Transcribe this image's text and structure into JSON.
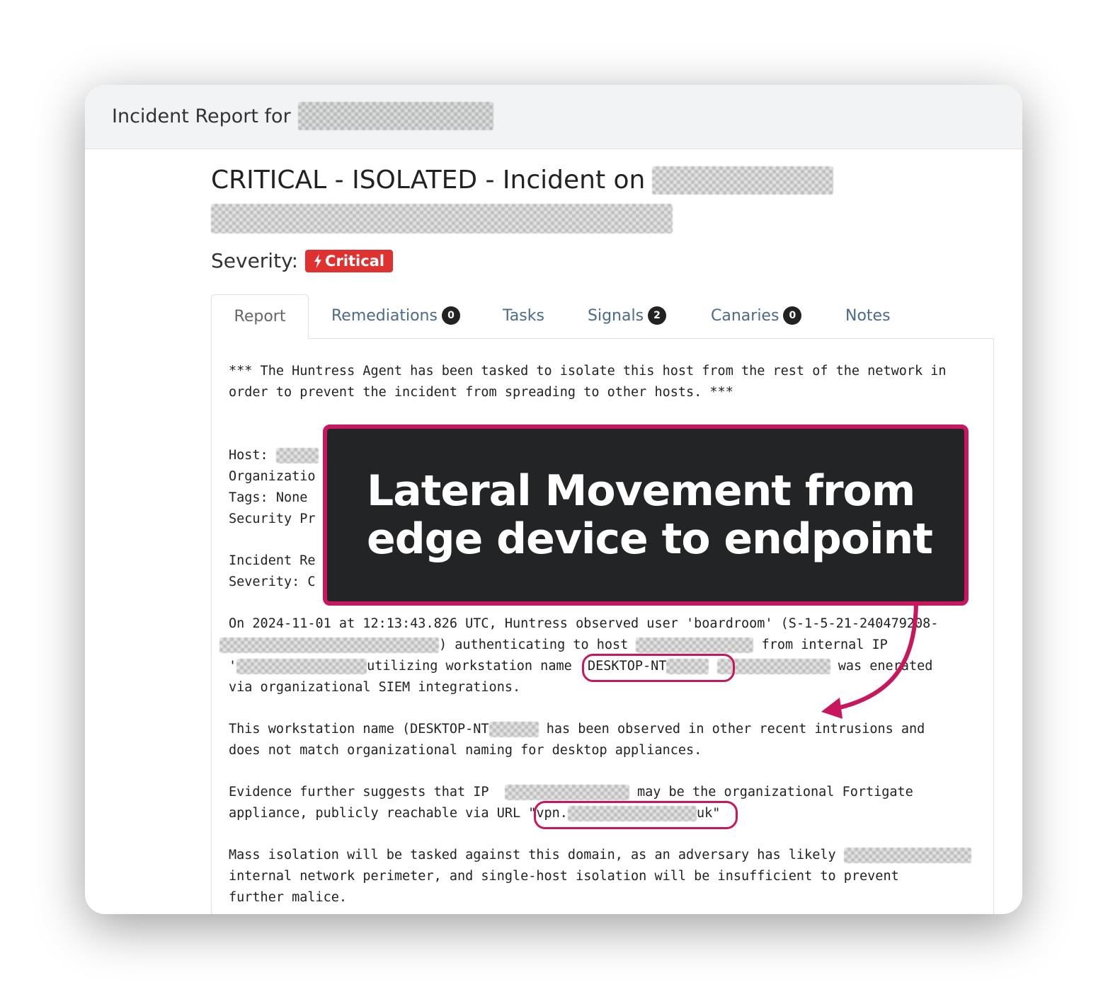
{
  "header": {
    "title": "Incident Report for"
  },
  "incident": {
    "title": "CRITICAL - ISOLATED - Incident on",
    "severity_label": "Severity:",
    "severity_badge": "Critical",
    "severity_icon": "bolt-icon",
    "badge_color": "#e03131"
  },
  "tabs": [
    {
      "label": "Report",
      "count": ""
    },
    {
      "label": "Remediations",
      "count": "0"
    },
    {
      "label": "Tasks",
      "count": ""
    },
    {
      "label": "Signals",
      "count": "2"
    },
    {
      "label": "Canaries",
      "count": "0"
    },
    {
      "label": "Notes",
      "count": ""
    }
  ],
  "report": {
    "intro1": "*** The Huntress Agent has been tasked to isolate this host from the rest of the network in",
    "intro2": "order to prevent the incident from spreading to other hosts. ***",
    "host": "Host:",
    "organization": "Organizatio",
    "tags": "Tags: None",
    "security": "Security Pr",
    "incident_re": "Incident Re",
    "severity_c": "Severity: C",
    "p1_l1": "On 2024-11-01 at 12:13:43.826 UTC, Huntress observed user 'boardroom' (S-1-5-21-2404",
    "p1_l1b": "79208-",
    "p1_l2a": ") authenticating to host",
    "p1_l2b": "from internal IP",
    "p1_l3a": "'",
    "p1_l3b": "utilizing workstation name",
    "p1_l3c": "'DESKTOP-NT",
    "p1_l3d": "was",
    "p1_l3e": "enerated",
    "p1_l4": "via organizational SIEM integrations.",
    "p2_l1a": "This workstation name (DESKTOP-NT",
    "p2_l1b": "has been observed in other recent intrusions and",
    "p2_l2": "does not match organizational naming for desktop appliances.",
    "p3_l1a": "Evidence further suggests that IP",
    "p3_l1b": "may be the organizational Fortigate",
    "p3_l2a": "appliance, publicly reachable via URL",
    "p3_l2b": "\"vpn.",
    "p3_l2c": "uk\"",
    "p4_l1": "Mass isolation will be tasked against this domain, as an adversary has likely",
    "p4_l2": "internal network perimeter, and single-host isolation will be insufficient to prevent",
    "p4_l3": "further malice."
  },
  "callout": {
    "line1": "Lateral Movement from",
    "line2": "edge device to endpoint",
    "accent": "#c8175d",
    "background": "#232425"
  }
}
